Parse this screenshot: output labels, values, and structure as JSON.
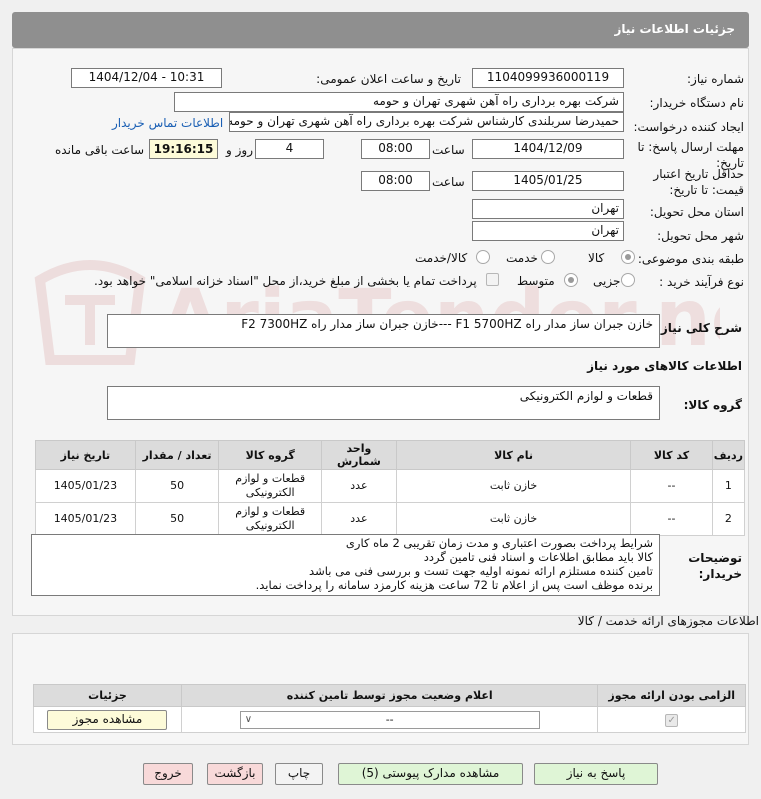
{
  "page": {
    "title": "جزئیات اطلاعات نیاز",
    "need_number_label": "شماره نیاز:",
    "need_number": "1104099936000119",
    "announce_label": "تاریخ و ساعت اعلان عمومی:",
    "announce_value": "1404/12/04 - 10:31",
    "buyer_label": "نام دستگاه خریدار:",
    "buyer_value": "شرکت بهره برداری راه آهن شهری تهران و حومه",
    "creator_label": "ایجاد کننده درخواست:",
    "creator_value": "حمیدرضا سربلندی کارشناس شرکت بهره برداری راه آهن شهری تهران و حومه",
    "contact_link": "اطلاعات تماس خریدار",
    "deadline_label_1": "مهلت ارسال پاسخ: تا",
    "deadline_label_2": "تاریخ:",
    "deadline_date": "1404/12/09",
    "time_label": "ساعت",
    "deadline_time": "08:00",
    "days_value": "4",
    "days_label": "روز و",
    "remaining_time": "19:16:15",
    "remaining_label": "ساعت باقی مانده",
    "validity_label_1": "حداقل تاریخ اعتبار",
    "validity_label_2": "قیمت: تا تاریخ:",
    "validity_date": "1405/01/25",
    "validity_time": "08:00",
    "province_label": "استان محل تحویل:",
    "province_value": "تهران",
    "city_label": "شهر محل تحویل:",
    "city_value": "تهران",
    "category_label": "طبقه بندی موضوعی:",
    "category_options": [
      "کالا",
      "خدمت",
      "کالا/خدمت"
    ],
    "process_label": "نوع فرآیند خرید :",
    "process_options": [
      "جزیی",
      "متوسط"
    ],
    "treasury_text": "پرداخت تمام یا بخشی از مبلغ خرید،از محل \"اسناد خزانه اسلامی\" خواهد بود.",
    "summary_label": "شرح کلی نیاز:",
    "summary_value": "خازن جبران ساز مدار راه F1 5700HZ ---خازن جبران ساز مدار راه F2 7300HZ",
    "goods_info_title": "اطلاعات کالاهای مورد نیاز",
    "goods_group_label": "گروه کالا:",
    "goods_group_value": "قطعات و لوازم الکترونیکی",
    "buyer_notes_label_1": "توضیحات",
    "buyer_notes_label_2": "خریدار:",
    "buyer_notes": [
      "شرایط پرداخت بصورت اعتباری و مدت زمان تقریبی 2 ماه کاری",
      "کالا باید مطابق اطلاعات و اسناد فنی تامین گردد",
      "تامین کننده مستلزم ارائه نمونه اولیه جهت تست و بررسی فنی می باشد",
      "برنده موظف است پس از اعلام  تا 72 ساعت هزینه کارمزد سامانه را پرداخت نماید."
    ],
    "license_section_title": "اطلاعات مجوزهای ارائه خدمت / کالا"
  },
  "items_table": {
    "headers": [
      "ردیف",
      "کد کالا",
      "نام کالا",
      "واحد شمارش",
      "گروه کالا",
      "تعداد / مقدار",
      "تاریخ نیاز"
    ],
    "rows": [
      [
        "1",
        "--",
        "خازن ثابت",
        "عدد",
        "قطعات و لوازم الکترونیکی",
        "50",
        "1405/01/23"
      ],
      [
        "2",
        "--",
        "خازن ثابت",
        "عدد",
        "قطعات و لوازم الکترونیکی",
        "50",
        "1405/01/23"
      ]
    ]
  },
  "license_table": {
    "headers": [
      "الزامی بودن ارائه مجوز",
      "اعلام وضعیت مجوز توسط تامین کننده",
      "جزئیات"
    ],
    "select_value": "--",
    "view_button": "مشاهده مجوز"
  },
  "buttons": {
    "reply": "پاسخ به نیاز",
    "attachments": "مشاهده مدارک پیوستی (5)",
    "print": "چاپ",
    "back": "بازگشت",
    "exit": "خروج"
  },
  "watermark": {
    "text": "AriaTender.neT"
  },
  "colors": {
    "header": "#8f8f8f",
    "link": "#1a5fb4",
    "timer_bg": "#fdfbd9",
    "green_button": "#dff5d6",
    "pink_button": "#f8d9d9"
  }
}
